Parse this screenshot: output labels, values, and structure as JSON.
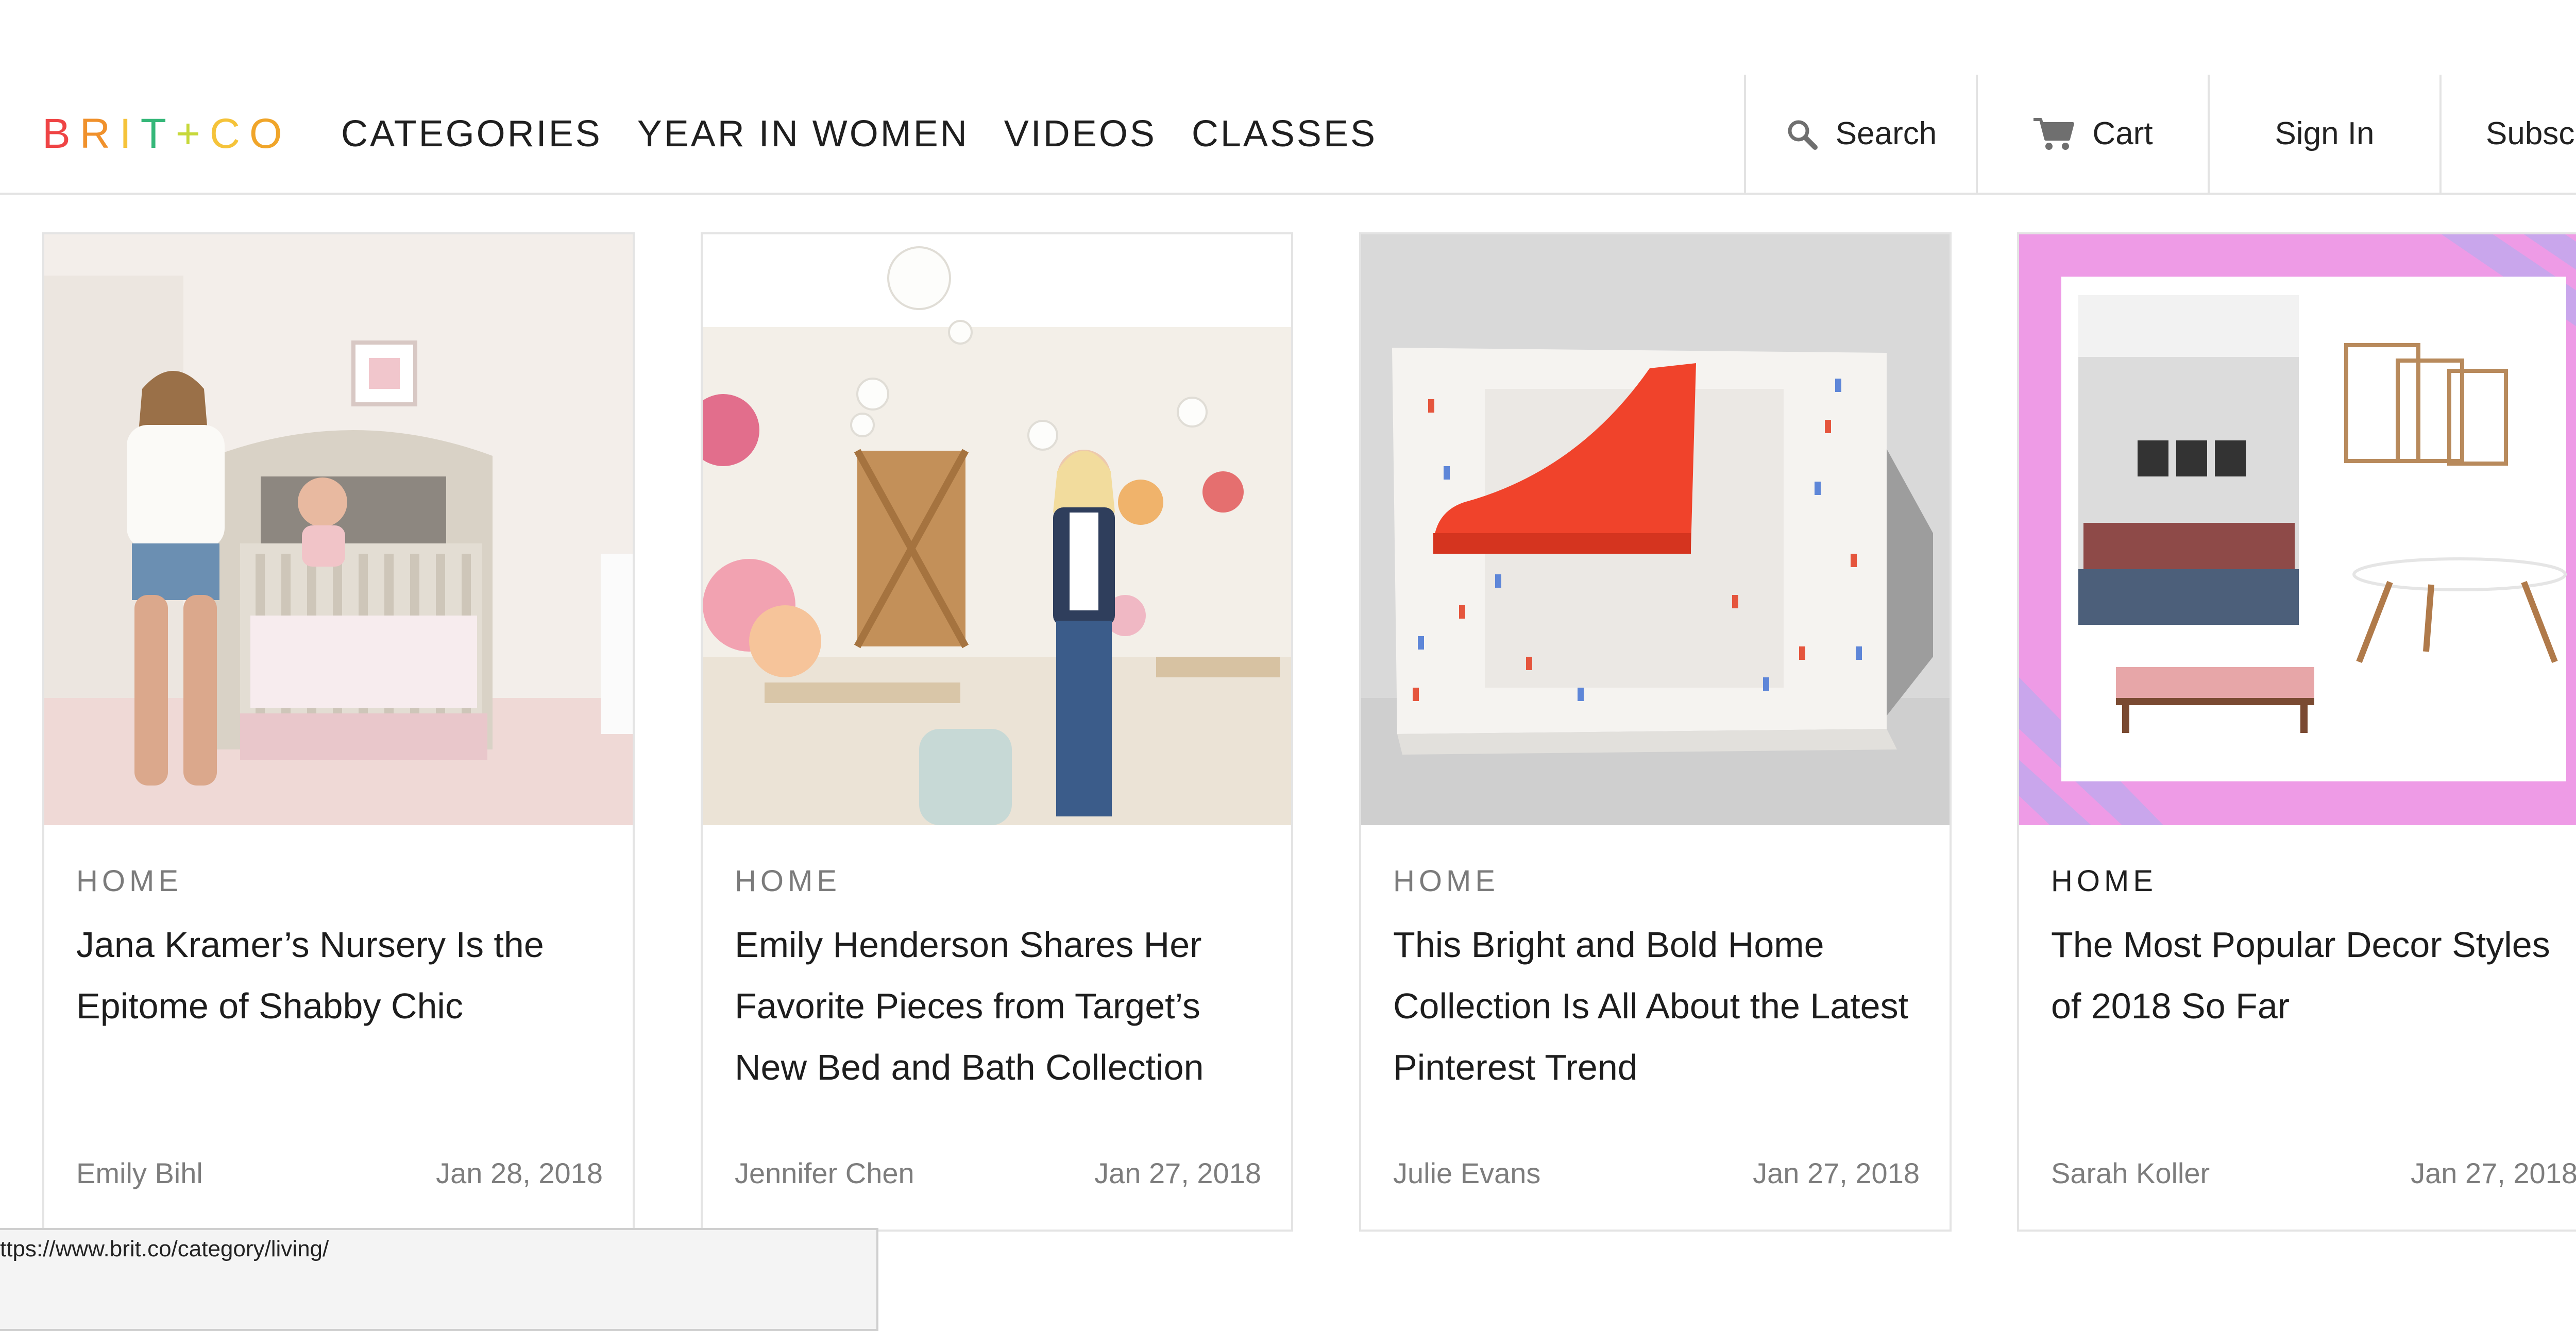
{
  "brand": {
    "logo_letters": [
      "B",
      "R",
      "I",
      "T",
      "+",
      "C",
      "O"
    ],
    "logo_colors": [
      "#ef4445",
      "#f0912c",
      "#f5c33a",
      "#35b779",
      "#c7d83a",
      "#f5c33a",
      "#f0a52a"
    ]
  },
  "nav": {
    "items": [
      "CATEGORIES",
      "YEAR IN WOMEN",
      "VIDEOS",
      "CLASSES"
    ]
  },
  "utility": {
    "search_label": "Search",
    "cart_label": "Cart",
    "signin_label": "Sign In",
    "subscribe_label": "Subscribe",
    "search_icon": "search-icon",
    "cart_icon": "cart-icon"
  },
  "cards": [
    {
      "category": "HOME",
      "title": "Jana Kramer’s Nursery Is the Epitome of Shabby Chic",
      "author": "Emily Bihl",
      "date": "Jan 28, 2018",
      "image": "nursery-photo"
    },
    {
      "category": "HOME",
      "title": "Emily Henderson Shares Her Favorite Pieces from Target’s New Bed and Bath Collection",
      "author": "Jennifer Chen",
      "date": "Jan 27, 2018",
      "image": "store-interior-photo"
    },
    {
      "category": "HOME",
      "title": "This Bright and Bold Home Collection Is All About the Latest Pinterest Trend",
      "author": "Julie Evans",
      "date": "Jan 27, 2018",
      "image": "terrazzo-chair-photo"
    },
    {
      "category": "HOME",
      "title": "The Most Popular Decor Styles of 2018 So Far",
      "author": "Sarah Koller",
      "date": "Jan 27, 2018",
      "image": "decor-collage-photo"
    }
  ],
  "status_bar": {
    "url": "ttps://www.brit.co/category/living/"
  }
}
